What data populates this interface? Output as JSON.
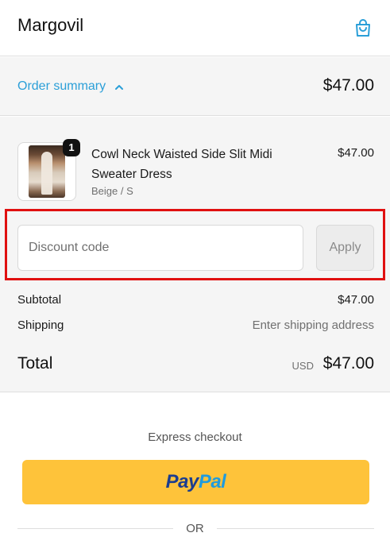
{
  "header": {
    "brand": "Margovil",
    "cart_icon": "shopping-bag-icon"
  },
  "summary_toggle": {
    "label": "Order summary",
    "chevron_icon": "chevron-up-icon",
    "total": "$47.00"
  },
  "line_items": [
    {
      "quantity": "1",
      "name": "Cowl Neck Waisted Side Slit Midi Sweater Dress",
      "variant": "Beige / S",
      "price": "$47.00"
    }
  ],
  "discount": {
    "placeholder": "Discount code",
    "value": "",
    "apply_label": "Apply"
  },
  "totals": {
    "subtotal_label": "Subtotal",
    "subtotal_value": "$47.00",
    "shipping_label": "Shipping",
    "shipping_value": "Enter shipping address",
    "total_label": "Total",
    "currency": "USD",
    "total_value": "$47.00"
  },
  "express": {
    "title": "Express checkout",
    "paypal_dark": "Pay",
    "paypal_light": "Pal",
    "divider_text": "OR"
  },
  "colors": {
    "accent_link": "#2b9fd8",
    "highlight_border": "#e01010",
    "paypal_button": "#fec33a",
    "paypal_dark": "#1b3d8f",
    "paypal_light": "#1f9bde"
  }
}
